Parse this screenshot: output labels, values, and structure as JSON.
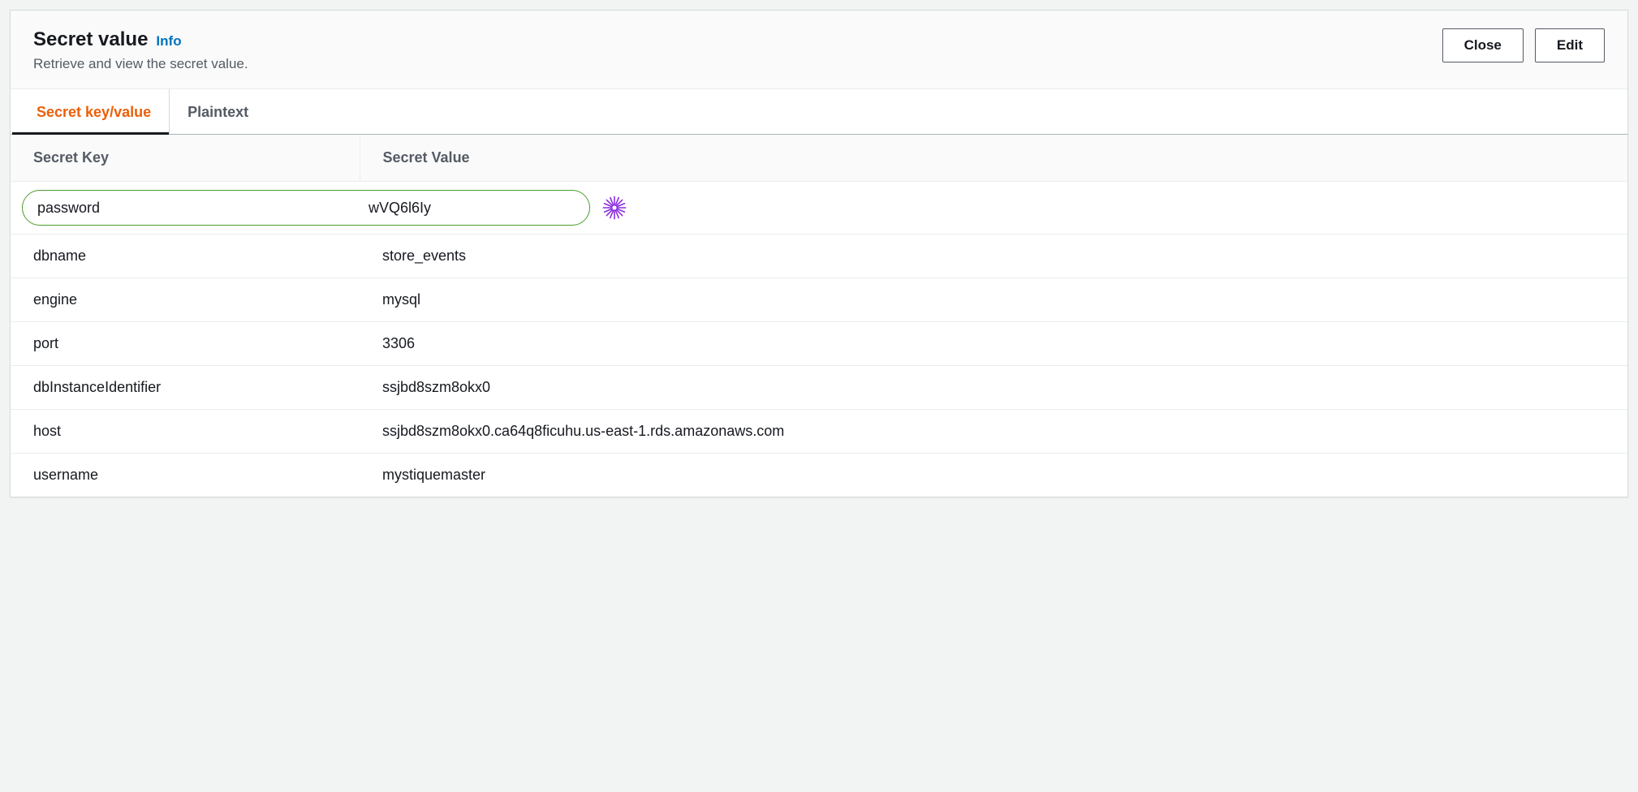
{
  "header": {
    "title": "Secret value",
    "info": "Info",
    "subtitle": "Retrieve and view the secret value.",
    "close": "Close",
    "edit": "Edit"
  },
  "tabs": {
    "kv": "Secret key/value",
    "plain": "Plaintext"
  },
  "table": {
    "col_key": "Secret Key",
    "col_value": "Secret Value"
  },
  "rows": [
    {
      "key": "password",
      "value": "wVQ6l6Iy",
      "highlighted": true
    },
    {
      "key": "dbname",
      "value": "store_events"
    },
    {
      "key": "engine",
      "value": "mysql"
    },
    {
      "key": "port",
      "value": "3306"
    },
    {
      "key": "dbInstanceIdentifier",
      "value": "ssjbd8szm8okx0"
    },
    {
      "key": "host",
      "value": "ssjbd8szm8okx0.ca64q8ficuhu.us-east-1.rds.amazonaws.com"
    },
    {
      "key": "username",
      "value": "mystiquemaster"
    }
  ]
}
